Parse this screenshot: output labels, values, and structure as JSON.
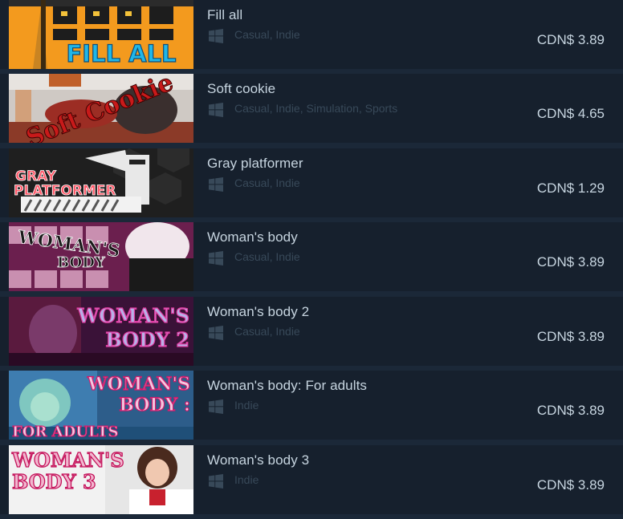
{
  "results": [
    {
      "title": "Fill all",
      "tags": "Casual, Indie",
      "price": "CDN$ 3.89",
      "platform_icon": "windows-icon",
      "capsule_text": [
        "FILL ALL"
      ]
    },
    {
      "title": "Soft cookie",
      "tags": "Casual, Indie, Simulation, Sports",
      "price": "CDN$ 4.65",
      "platform_icon": "windows-icon",
      "capsule_text": [
        "Soft Cookie"
      ]
    },
    {
      "title": "Gray platformer",
      "tags": "Casual, Indie",
      "price": "CDN$ 1.29",
      "platform_icon": "windows-icon",
      "capsule_text": [
        "GRAY",
        "PLATFORMER"
      ]
    },
    {
      "title": "Woman's body",
      "tags": "Casual, Indie",
      "price": "CDN$ 3.89",
      "platform_icon": "windows-icon",
      "capsule_text": [
        "WOMAN'S",
        "BODY"
      ]
    },
    {
      "title": "Woman's body 2",
      "tags": "Casual, Indie",
      "price": "CDN$ 3.89",
      "platform_icon": "windows-icon",
      "capsule_text": [
        "WOMAN'S",
        "BODY 2"
      ]
    },
    {
      "title": "Woman's body: For adults",
      "tags": "Indie",
      "price": "CDN$ 3.89",
      "platform_icon": "windows-icon",
      "capsule_text": [
        "WOMAN'S",
        "BODY :",
        "FOR ADULTS"
      ]
    },
    {
      "title": "Woman's body 3",
      "tags": "Indie",
      "price": "CDN$ 3.89",
      "platform_icon": "windows-icon",
      "capsule_text": [
        "WOMAN'S",
        "BODY 3"
      ]
    }
  ],
  "colors": {
    "page_bg": "#1b2838",
    "row_bg": "#16202d",
    "title": "#c7d5e0",
    "tags": "#384959",
    "price": "#c7d5e0"
  }
}
